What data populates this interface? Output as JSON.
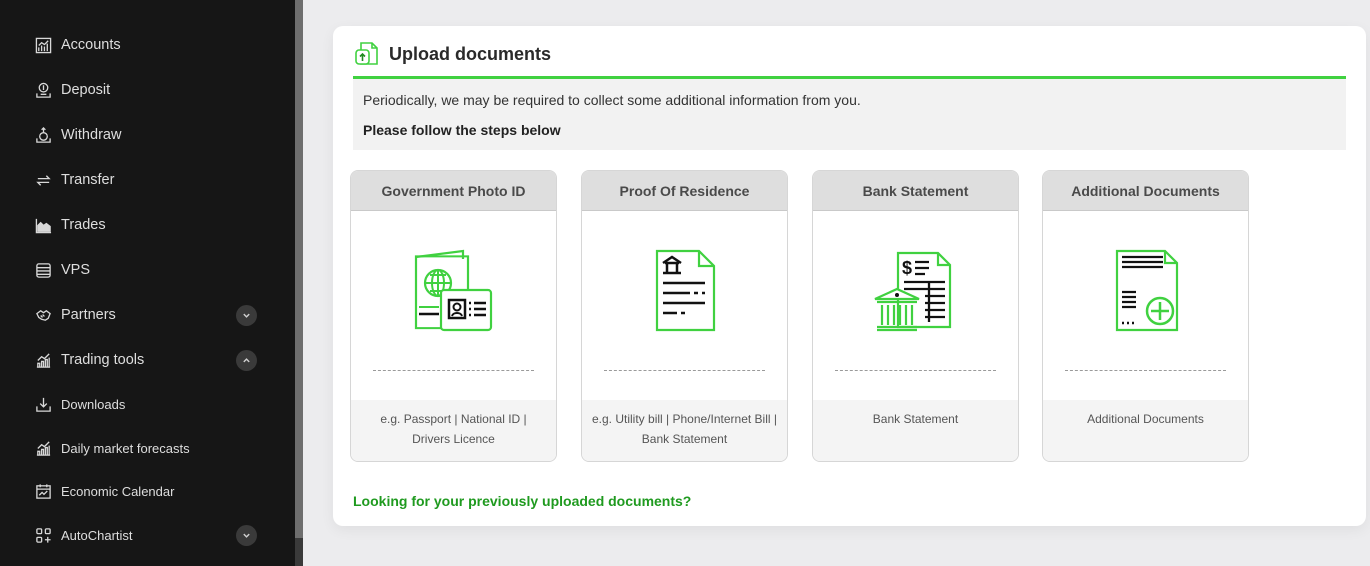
{
  "sidebar": {
    "items": [
      {
        "label": "Accounts",
        "icon": "chart-icon"
      },
      {
        "label": "Deposit",
        "icon": "deposit-icon"
      },
      {
        "label": "Withdraw",
        "icon": "withdraw-icon"
      },
      {
        "label": "Transfer",
        "icon": "transfer-icon"
      },
      {
        "label": "Trades",
        "icon": "area-chart-icon"
      },
      {
        "label": "VPS",
        "icon": "server-icon"
      },
      {
        "label": "Partners",
        "icon": "handshake-icon",
        "expand": "collapsed"
      },
      {
        "label": "Trading tools",
        "icon": "bar-chart-icon",
        "expand": "expanded"
      },
      {
        "label": "Downloads",
        "icon": "download-icon"
      },
      {
        "label": "Daily market forecasts",
        "icon": "bar-chart-icon"
      },
      {
        "label": "Economic Calendar",
        "icon": "calendar-icon"
      },
      {
        "label": "AutoChartist",
        "icon": "grid-plus-icon",
        "expand": "collapsed"
      }
    ]
  },
  "main": {
    "title": "Upload documents",
    "info_line1": "Periodically, we may be required to collect some additional information from you.",
    "info_line2": "Please follow the steps below",
    "documents": [
      {
        "title": "Government Photo ID",
        "desc_line1": "e.g. Passport | National ID |",
        "desc_line2": "Drivers Licence",
        "icon": "passport-id-icon"
      },
      {
        "title": "Proof Of Residence",
        "desc_line1": "e.g. Utility bill | Phone/Internet Bill |",
        "desc_line2": "Bank Statement",
        "icon": "residence-document-icon"
      },
      {
        "title": "Bank Statement",
        "desc_line1": "Bank Statement",
        "desc_line2": "",
        "icon": "bank-statement-icon"
      },
      {
        "title": "Additional Documents",
        "desc_line1": "Additional Documents",
        "desc_line2": "",
        "icon": "add-document-icon"
      }
    ],
    "previous_link": "Looking for your previously uploaded documents?"
  },
  "colors": {
    "accent_green": "#40d140",
    "link_green": "#1f9a1f",
    "sidebar_bg": "#161616"
  }
}
